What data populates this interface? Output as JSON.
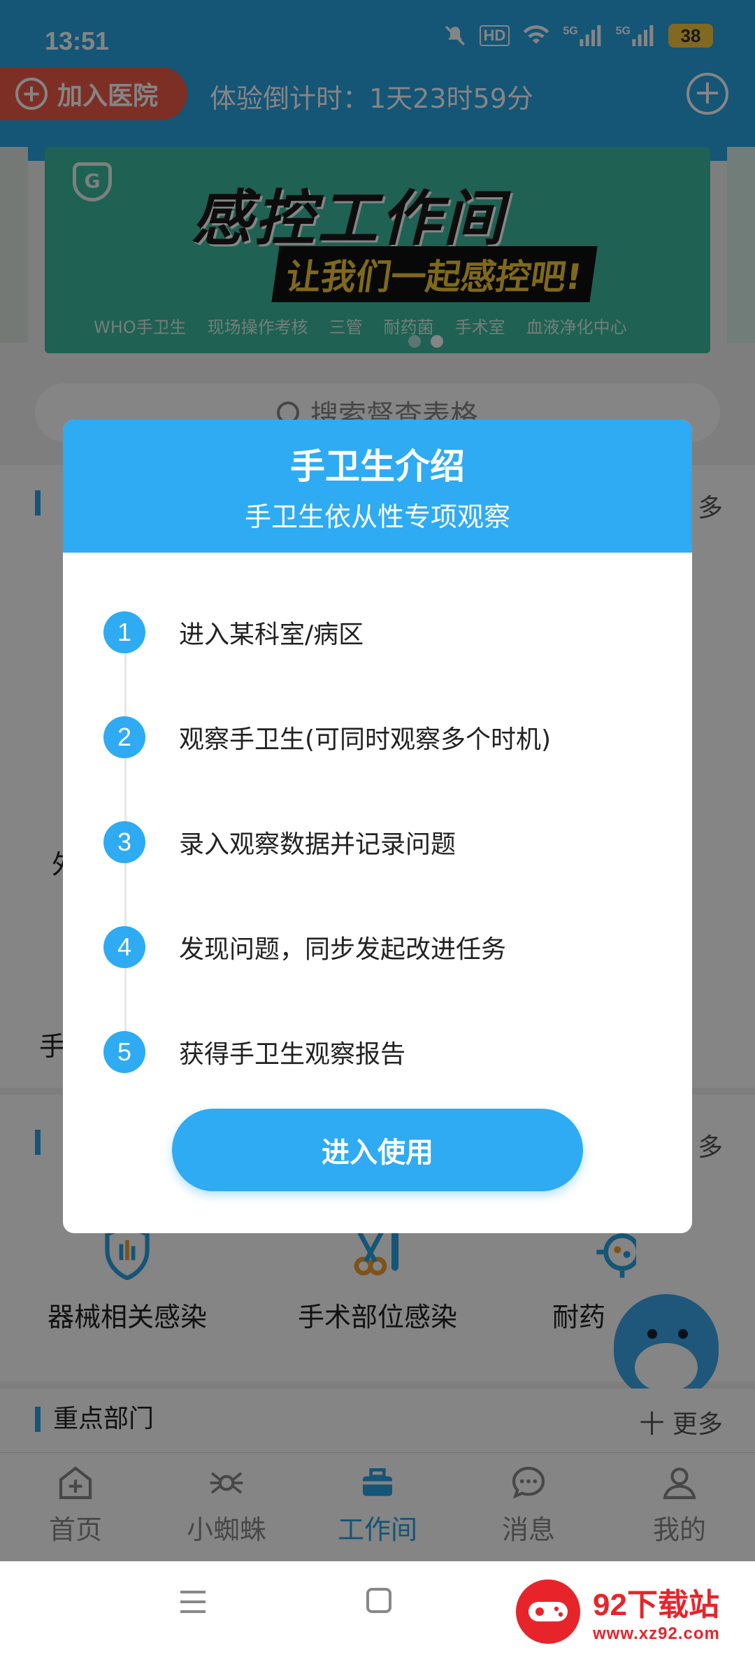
{
  "status_bar": {
    "time": "13:51",
    "icons": [
      "mute-icon",
      "hd-icon",
      "wifi-icon",
      "signal-5g-icon",
      "signal-5g-icon"
    ],
    "hd_label": "HD",
    "net_label": "5G",
    "battery": "38"
  },
  "header": {
    "join_label": "加入医院",
    "countdown": "体验倒计时：1天23时59分"
  },
  "banner": {
    "title": "感控工作间",
    "subtitle": "让我们一起感控吧!",
    "logo_text": "G",
    "tags": [
      "WHO手卫生",
      "现场操作考核",
      "三管",
      "耐药菌",
      "手术室",
      "血液净化中心"
    ]
  },
  "search": {
    "placeholder": "搜索督查表格"
  },
  "background": {
    "more_label": "多",
    "more_full": "十 更多",
    "section_key_depts": "重点部门",
    "ghost_1": "外",
    "ghost_2": "手",
    "categories": [
      "器械相关感染",
      "手术部位感染",
      "耐药"
    ]
  },
  "tabbar": {
    "items": [
      {
        "label": "首页",
        "icon": "home-plus-icon"
      },
      {
        "label": "小蜘蛛",
        "icon": "spider-icon"
      },
      {
        "label": "工作间",
        "icon": "toolbox-icon"
      },
      {
        "label": "消息",
        "icon": "chat-icon"
      },
      {
        "label": "我的",
        "icon": "user-icon"
      }
    ],
    "active_index": 2
  },
  "watermark": {
    "title": "92下载站",
    "url": "www.xz92.com"
  },
  "dialog": {
    "title": "手卫生介绍",
    "subtitle": "手卫生依从性专项观察",
    "steps": [
      {
        "num": "1",
        "text": "进入某科室/病区"
      },
      {
        "num": "2",
        "text": "观察手卫生(可同时观察多个时机)"
      },
      {
        "num": "3",
        "text": "录入观察数据并记录问题"
      },
      {
        "num": "4",
        "text": "发现问题，同步发起改进任务"
      },
      {
        "num": "5",
        "text": "获得手卫生观察报告"
      }
    ],
    "button_label": "进入使用"
  },
  "colors": {
    "accent": "#2eabf2",
    "join_red": "#f05a4a",
    "overlay": "rgba(0,0,0,0.48)"
  }
}
